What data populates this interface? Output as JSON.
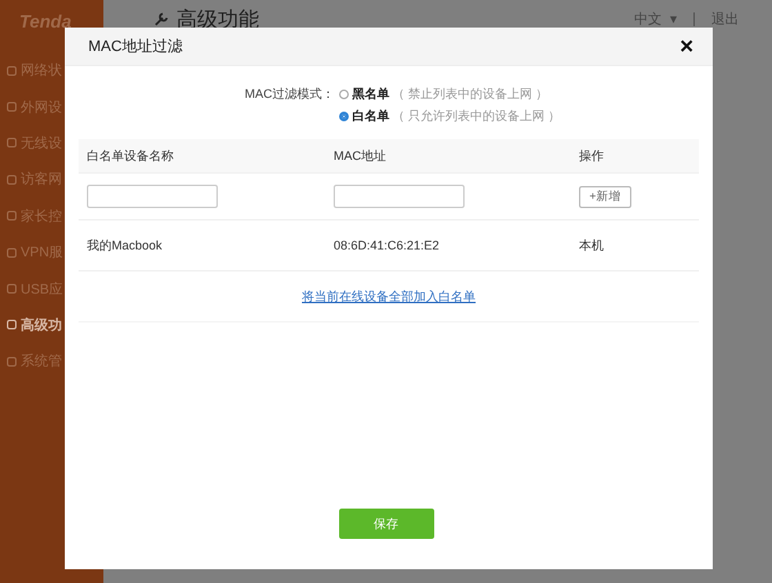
{
  "header": {
    "logo": "Tenda",
    "title": "高级功能",
    "language": "中文",
    "language_caret": "▾",
    "logout": "退出"
  },
  "sidebar": {
    "items": [
      {
        "label": "网络状",
        "selected": false
      },
      {
        "label": "外网设",
        "selected": false
      },
      {
        "label": "无线设",
        "selected": false
      },
      {
        "label": "访客网",
        "selected": false
      },
      {
        "label": "家长控",
        "selected": false
      },
      {
        "label": "VPN服",
        "selected": false
      },
      {
        "label": "USB应",
        "selected": false
      },
      {
        "label": "高级功",
        "selected": true
      },
      {
        "label": "系统管",
        "selected": false
      }
    ]
  },
  "dialog": {
    "title": "MAC地址过滤",
    "close": "×",
    "mode": {
      "label": "MAC过滤模式：",
      "options": [
        {
          "label": "黑名单",
          "note": "（ 禁止列表中的设备上网 ）",
          "selected": false
        },
        {
          "label": "白名单",
          "note": "（ 只允许列表中的设备上网 ）",
          "selected": true
        }
      ]
    },
    "table": {
      "columns": [
        "白名单设备名称",
        "MAC地址",
        "操作"
      ],
      "add_button": "+新增",
      "rows": [
        {
          "name": "我的Macbook",
          "mac": "08:6D:41:C6:21:E2",
          "action": "本机"
        }
      ]
    },
    "link": "将当前在线设备全部加入白名单",
    "save_button": "保存"
  }
}
